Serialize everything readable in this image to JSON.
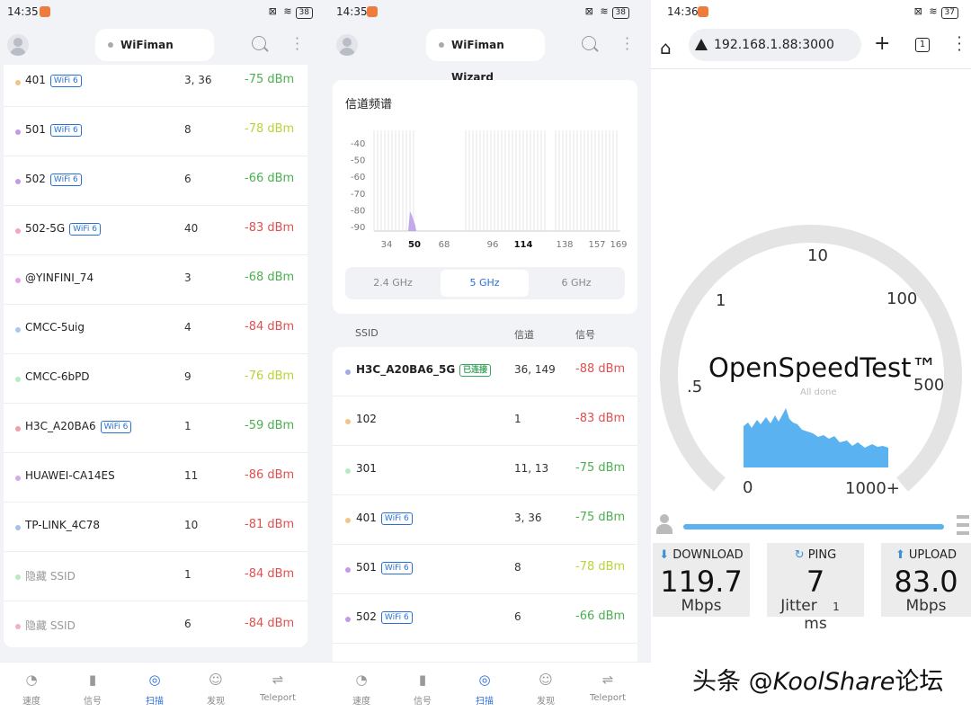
{
  "panel1": {
    "status": {
      "time": "14:35",
      "battery": "38"
    },
    "header": {
      "title": "WiFiman Wizard"
    },
    "networks": [
      {
        "ssid": "401",
        "badge": "WiFi 6",
        "channel": "3, 36",
        "signal": "-75 dBm",
        "dot": "#f2c48a",
        "sigcolor": "#4caf50"
      },
      {
        "ssid": "501",
        "badge": "WiFi 6",
        "channel": "8",
        "signal": "-78 dBm",
        "dot": "#c49ae8",
        "sigcolor": "#b8d43a"
      },
      {
        "ssid": "502",
        "badge": "WiFi 6",
        "channel": "6",
        "signal": "-66 dBm",
        "dot": "#c49ae8",
        "sigcolor": "#4caf50"
      },
      {
        "ssid": "502-5G",
        "badge": "WiFi 6",
        "channel": "40",
        "signal": "-83 dBm",
        "dot": "#f2a3c8",
        "sigcolor": "#e05050"
      },
      {
        "ssid": "@YINFINI_74",
        "badge": "",
        "channel": "3",
        "signal": "-68 dBm",
        "dot": "#e6a0e8",
        "sigcolor": "#4caf50"
      },
      {
        "ssid": "CMCC-5uig",
        "badge": "",
        "channel": "4",
        "signal": "-84 dBm",
        "dot": "#a8c8f0",
        "sigcolor": "#e05050"
      },
      {
        "ssid": "CMCC-6bPD",
        "badge": "",
        "channel": "9",
        "signal": "-76 dBm",
        "dot": "#b6ecc0",
        "sigcolor": "#b8d43a"
      },
      {
        "ssid": "H3C_A20BA6",
        "badge": "WiFi 6",
        "channel": "1",
        "signal": "-59 dBm",
        "dot": "#f0a0a8",
        "sigcolor": "#4caf50"
      },
      {
        "ssid": "HUAWEI-CA14ES",
        "badge": "",
        "channel": "11",
        "signal": "-86 dBm",
        "dot": "#d8a8e8",
        "sigcolor": "#e05050"
      },
      {
        "ssid": "TP-LINK_4C78",
        "badge": "",
        "channel": "10",
        "signal": "-81 dBm",
        "dot": "#a8c0e8",
        "sigcolor": "#e05050"
      },
      {
        "ssid": "隐藏 SSID",
        "badge": "",
        "channel": "1",
        "signal": "-84 dBm",
        "dot": "#b6ecc0",
        "sigcolor": "#e05050",
        "muted": true
      },
      {
        "ssid": "隐藏 SSID",
        "badge": "",
        "channel": "6",
        "signal": "-84 dBm",
        "dot": "#f2b0c0",
        "sigcolor": "#e05050",
        "muted": true
      }
    ]
  },
  "nav": [
    {
      "label": "速度",
      "icon": "speedometer-icon",
      "glyph": "◔"
    },
    {
      "label": "信号",
      "icon": "signal-bars-icon",
      "glyph": "▮"
    },
    {
      "label": "扫描",
      "icon": "scan-icon",
      "glyph": "◎",
      "active": true
    },
    {
      "label": "发现",
      "icon": "discover-robot-icon",
      "glyph": "☺"
    },
    {
      "label": "Teleport",
      "icon": "teleport-icon",
      "glyph": "⇌"
    }
  ],
  "panel2": {
    "status": {
      "time": "14:35",
      "battery": "38"
    },
    "header": {
      "title": "WiFiman Wizard"
    },
    "spectrum": {
      "title": "信道频谱",
      "y_ticks": [
        "-40",
        "-50",
        "-60",
        "-70",
        "-80",
        "-90"
      ],
      "x_ticks": [
        {
          "label": "34",
          "bold": false
        },
        {
          "label": "50",
          "bold": true
        },
        {
          "label": "68",
          "bold": false
        },
        {
          "label": "96",
          "bold": false
        },
        {
          "label": "114",
          "bold": true
        },
        {
          "label": "138",
          "bold": false
        },
        {
          "label": "157",
          "bold": false
        },
        {
          "label": "169",
          "bold": false
        }
      ],
      "bands": [
        "2.4 GHz",
        "5 GHz",
        "6 GHz"
      ],
      "active_band": "5 GHz"
    },
    "columns": {
      "ssid": "SSID",
      "channel": "信道",
      "signal": "信号"
    },
    "networks": [
      {
        "ssid": "H3C_A20BA6_5G",
        "badge": "已连接",
        "connected": true,
        "channel": "36, 149",
        "signal": "-88 dBm",
        "dot": "#a8a8e8",
        "sigcolor": "#e05050"
      },
      {
        "ssid": "102",
        "badge": "",
        "channel": "1",
        "signal": "-83 dBm",
        "dot": "#f2c48a",
        "sigcolor": "#e05050"
      },
      {
        "ssid": "301",
        "badge": "",
        "channel": "11, 13",
        "signal": "-75 dBm",
        "dot": "#b6ecc0",
        "sigcolor": "#4caf50"
      },
      {
        "ssid": "401",
        "badge": "WiFi 6",
        "channel": "3, 36",
        "signal": "-75 dBm",
        "dot": "#f2c48a",
        "sigcolor": "#4caf50"
      },
      {
        "ssid": "501",
        "badge": "WiFi 6",
        "channel": "8",
        "signal": "-78 dBm",
        "dot": "#c49ae8",
        "sigcolor": "#b8d43a"
      },
      {
        "ssid": "502",
        "badge": "WiFi 6",
        "channel": "6",
        "signal": "-66 dBm",
        "dot": "#c49ae8",
        "sigcolor": "#4caf50"
      }
    ]
  },
  "panel3": {
    "status": {
      "time": "14:36",
      "battery": "37"
    },
    "browser": {
      "url": "192.168.1.88:3000",
      "tab_count": "1"
    },
    "speedtest": {
      "title": "OpenSpeedTest™",
      "subtitle": "All done",
      "gauge_labels": [
        "0",
        ".5",
        "1",
        "10",
        "100",
        "500",
        "1000+"
      ],
      "gauge_progress": 1.0,
      "download": {
        "label": "DOWNLOAD",
        "value": "119.7",
        "unit": "Mbps"
      },
      "ping": {
        "label": "PING",
        "value": "7",
        "jitter_label": "Jitter",
        "jitter_value": "1",
        "unit": "ms"
      },
      "upload": {
        "label": "UPLOAD",
        "value": "83.0",
        "unit": "Mbps"
      }
    },
    "watermark": {
      "prefix": "头条 @",
      "brand": "KoolShare",
      "suffix": "论坛"
    }
  },
  "colors": {
    "accent": "#2a6fd6",
    "good": "#4caf50",
    "fair": "#b8d43a",
    "bad": "#e05050",
    "speed": "#5ab3f0"
  }
}
